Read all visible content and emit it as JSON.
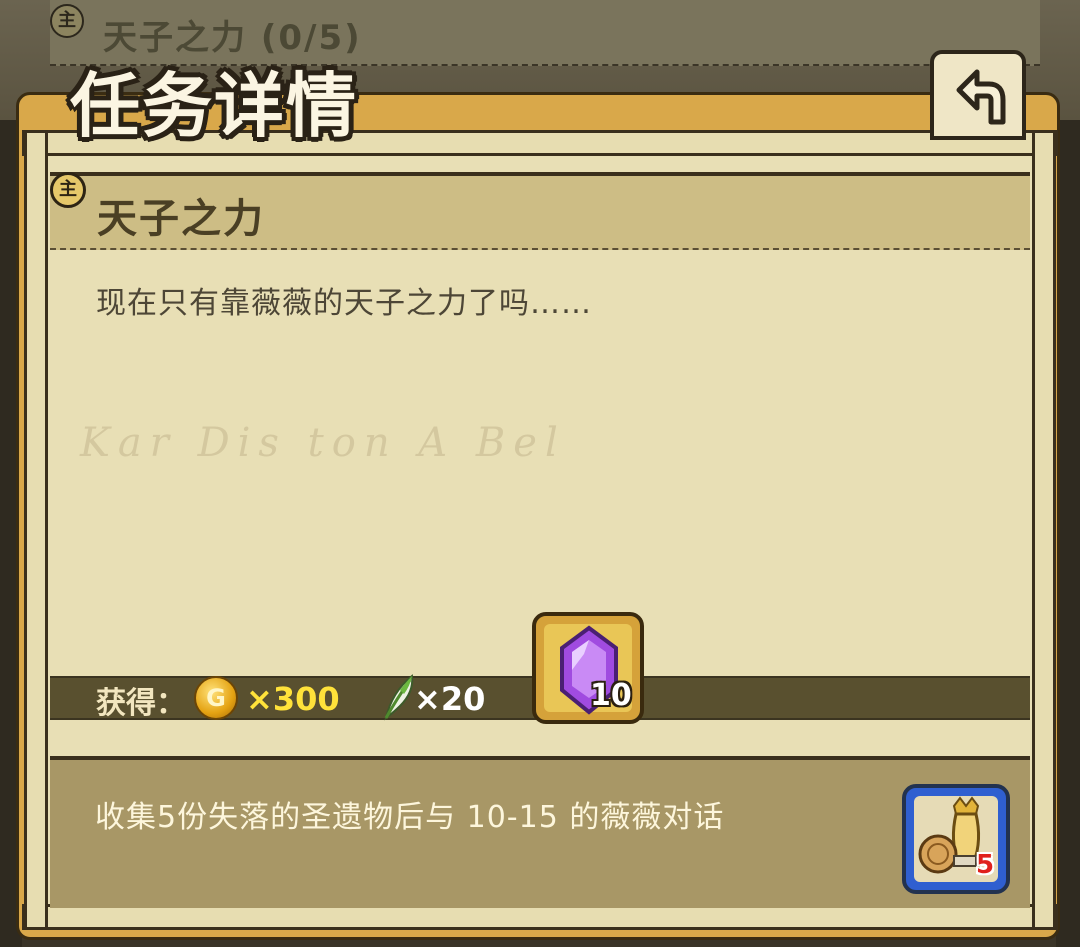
{
  "background_quest": {
    "badge": "主",
    "title": "天子之力 (0/5)"
  },
  "panel": {
    "title": "任务详情",
    "back_icon": "back-arrow-icon"
  },
  "quest": {
    "badge": "主",
    "name": "天子之力",
    "description": "现在只有靠薇薇的天子之力了吗……"
  },
  "rewards": {
    "label": "获得：",
    "coin": {
      "icon": "gold-coin-icon",
      "symbol": "G",
      "amount": "×300",
      "color": "#ffe23a"
    },
    "feather": {
      "icon": "feather-icon",
      "amount": "×20"
    },
    "gem": {
      "icon": "purple-gem-icon",
      "count": "10"
    }
  },
  "objective": {
    "text": "收集5份失落的圣遗物后与 10-15 的薇薇对话",
    "relic": {
      "icon": "relic-items-icon",
      "count": "5"
    }
  }
}
